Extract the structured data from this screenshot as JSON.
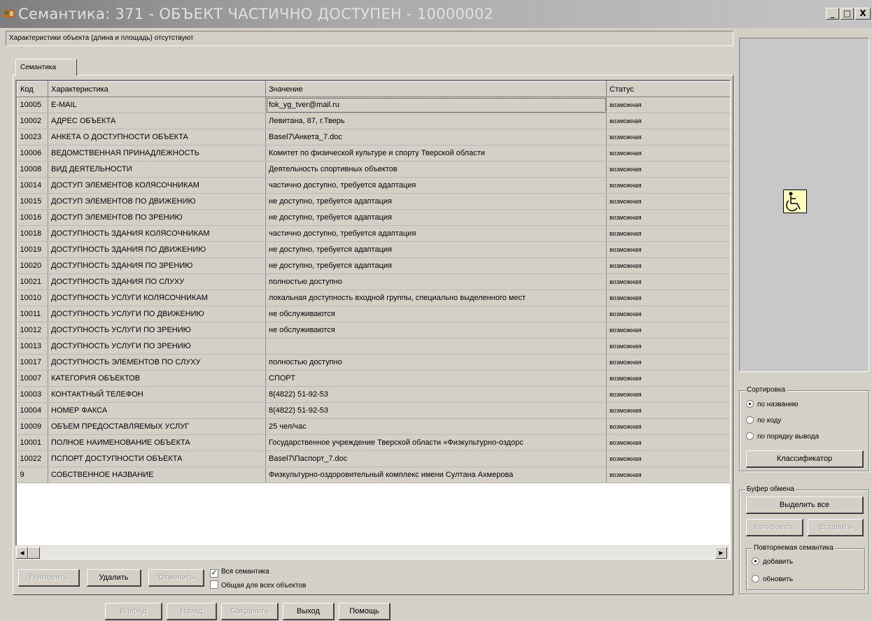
{
  "window": {
    "title": "Семантика: 371 - ОБЪЕКТ ЧАСТИЧНО ДОСТУПЕН - 10000002",
    "minimize": "_",
    "maximize": "□",
    "close": "X"
  },
  "info_text": "Характеристики объекта (длина и площадь) отсутствуют",
  "tab_label": "Семантика",
  "table": {
    "headers": {
      "code": "Код",
      "name": "Характеристика",
      "value": "Значение",
      "status": "Статус"
    },
    "rows": [
      {
        "code": "10005",
        "name": "E-MAIL",
        "value": "fok_yg_tver@mail.ru",
        "status": "возможная"
      },
      {
        "code": "10002",
        "name": "АДРЕС ОБЪЕКТА",
        "value": "Левитана, 87, г.Тверь",
        "status": "возможная"
      },
      {
        "code": "10023",
        "name": "АНКЕТА О ДОСТУПНОСТИ ОБЪЕКТА",
        "value": "Basel7\\Анкета_7.doc",
        "status": "возможная"
      },
      {
        "code": "10006",
        "name": "ВЕДОМСТВЕННАЯ ПРИНАДЛЕЖНОСТЬ",
        "value": "Комитет по физической культуре и спорту Тверской области",
        "status": "возможная"
      },
      {
        "code": "10008",
        "name": "ВИД ДЕЯТЕЛЬНОСТИ",
        "value": "Деятельность спортивных объектов",
        "status": "возможная"
      },
      {
        "code": "10014",
        "name": "ДОСТУП ЭЛЕМЕНТОВ КОЛЯСОЧНИКАМ",
        "value": "частично доступно, требуется адаптация",
        "status": "возможная"
      },
      {
        "code": "10015",
        "name": "ДОСТУП ЭЛЕМЕНТОВ ПО ДВИЖЕНИЮ",
        "value": "не доступно, требуется адаптация",
        "status": "возможная"
      },
      {
        "code": "10016",
        "name": "ДОСТУП ЭЛЕМЕНТОВ ПО ЗРЕНИЮ",
        "value": "не доступно, требуется адаптация",
        "status": "возможная"
      },
      {
        "code": "10018",
        "name": "ДОСТУПНОСТЬ ЗДАНИЯ КОЛЯСОЧНИКАМ",
        "value": "частично доступно, требуется адаптация",
        "status": "возможная"
      },
      {
        "code": "10019",
        "name": "ДОСТУПНОСТЬ ЗДАНИЯ ПО ДВИЖЕНИЮ",
        "value": "не доступно, требуется адаптация",
        "status": "возможная"
      },
      {
        "code": "10020",
        "name": "ДОСТУПНОСТЬ ЗДАНИЯ ПО ЗРЕНИЮ",
        "value": "не доступно, требуется адаптация",
        "status": "возможная"
      },
      {
        "code": "10021",
        "name": "ДОСТУПНОСТЬ ЗДАНИЯ ПО СЛУХУ",
        "value": "полностью доступно",
        "status": "возможная"
      },
      {
        "code": "10010",
        "name": "ДОСТУПНОСТЬ УСЛУГИ КОЛЯСОЧНИКАМ",
        "value": "локальная доступность входной группы, специально выделенного мест",
        "status": "возможная"
      },
      {
        "code": "10011",
        "name": "ДОСТУПНОСТЬ УСЛУГИ ПО ДВИЖЕНИЮ",
        "value": "не обслуживаются",
        "status": "возможная"
      },
      {
        "code": "10012",
        "name": "ДОСТУПНОСТЬ УСЛУГИ ПО ЗРЕНИЮ",
        "value": "не обслуживаются",
        "status": "возможная"
      },
      {
        "code": "10013",
        "name": "ДОСТУПНОСТЬ УСЛУГИ ПО ЗРЕНИЮ",
        "value": "",
        "status": "возможная"
      },
      {
        "code": "10017",
        "name": "ДОСТУПНОСТЬ ЭЛЕМЕНТОВ ПО СЛУХУ",
        "value": "полностью доступно",
        "status": "возможная"
      },
      {
        "code": "10007",
        "name": "КАТЕГОРИЯ ОБЪЕКТОВ",
        "value": "СПОРТ",
        "status": "возможная"
      },
      {
        "code": "10003",
        "name": "КОНТАКТНЫЙ ТЕЛЕФОН",
        "value": "8(4822) 51-92-53",
        "status": "возможная"
      },
      {
        "code": "10004",
        "name": "НОМЕР ФАКСА",
        "value": "8(4822) 51-92-53",
        "status": "возможная"
      },
      {
        "code": "10009",
        "name": "ОБЪЕМ ПРЕДОСТАВЛЯЕМЫХ УСЛУГ",
        "value": "25 чел/час",
        "status": "возможная"
      },
      {
        "code": "10001",
        "name": "ПОЛНОЕ НАИМЕНОВАНИЕ ОБЪЕКТА",
        "value": "Государственное учреждение Тверской области «Физкультурно-оздорс",
        "status": "возможная"
      },
      {
        "code": "10022",
        "name": "ПСПОРТ ДОСТУПНОСТИ ОБЪЕКТА",
        "value": "Basel7\\Паспорт_7.doc",
        "status": "возможная"
      },
      {
        "code": "9",
        "name": "СОБСТВЕННОЕ НАЗВАНИЕ",
        "value": "Физкультурно-оздоровительный комплекс имени Султана Ахмерова",
        "status": "возможная"
      }
    ]
  },
  "bottom_buttons": {
    "repeat": "Повторить",
    "delete": "Удалить",
    "cancel": "Отменить"
  },
  "checkboxes": {
    "all_semantics": {
      "label": "Вся семантика",
      "checked": true
    },
    "common_for_all": {
      "label": "Общая для всех объектов",
      "checked": false
    }
  },
  "footer_buttons": {
    "forward": "Вперёд",
    "back": "Назад",
    "save": "Сохранить",
    "exit": "Выход",
    "help": "Помощь"
  },
  "sorting": {
    "legend": "Сортировка",
    "options": [
      "по названию",
      "по коду",
      "по порядку вывода"
    ],
    "selected": 0,
    "classifier_button": "Классификатор"
  },
  "clipboard": {
    "legend": "Буфер обмена",
    "select_all": "Выделить все",
    "copy": "Копировать",
    "paste": "Вставить",
    "repeat_group": {
      "legend": "Повторяемая семантика",
      "options": [
        "добавить",
        "обновить"
      ],
      "selected": 0
    }
  },
  "colors": {
    "face": "#d4d0c8",
    "symbol_bg": "#ffffc0"
  },
  "icons": [
    "app-icon",
    "wheelchair-icon",
    "arrow-left-icon",
    "arrow-right-icon"
  ]
}
